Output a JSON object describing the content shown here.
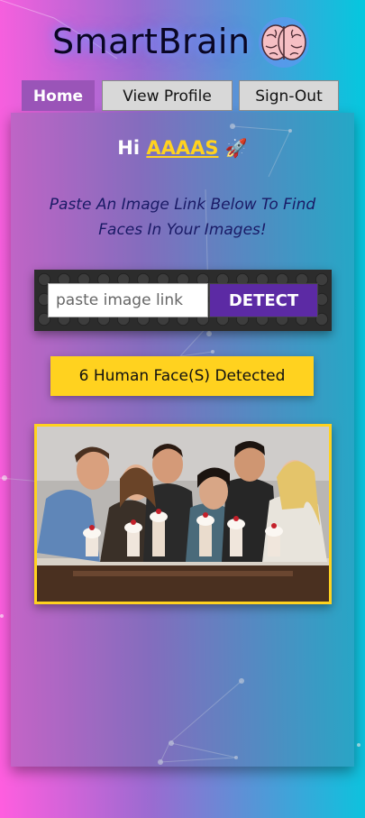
{
  "app": {
    "brand": "SmartBrain",
    "logo_icon": "brain-icon"
  },
  "nav": {
    "tabs": [
      {
        "label": "Home",
        "active": true
      },
      {
        "label": "View Profile",
        "active": false
      },
      {
        "label": "Sign-Out",
        "active": false
      }
    ]
  },
  "main": {
    "greeting_prefix": "Hi",
    "username": "AAAAS",
    "greeting_icon": "rocket-icon",
    "prompt": "Paste An Image Link Below To Find Faces In Your Images!",
    "input": {
      "value": "",
      "placeholder": "paste image link"
    },
    "detect_label": "DETECT",
    "face_count_text": "6 Human Face(S) Detected",
    "image_icon": "group-photo-image"
  },
  "colors": {
    "accent_yellow": "#ffd21f",
    "button_purple": "#5c2aa4",
    "active_tab": "#9a54b8"
  }
}
